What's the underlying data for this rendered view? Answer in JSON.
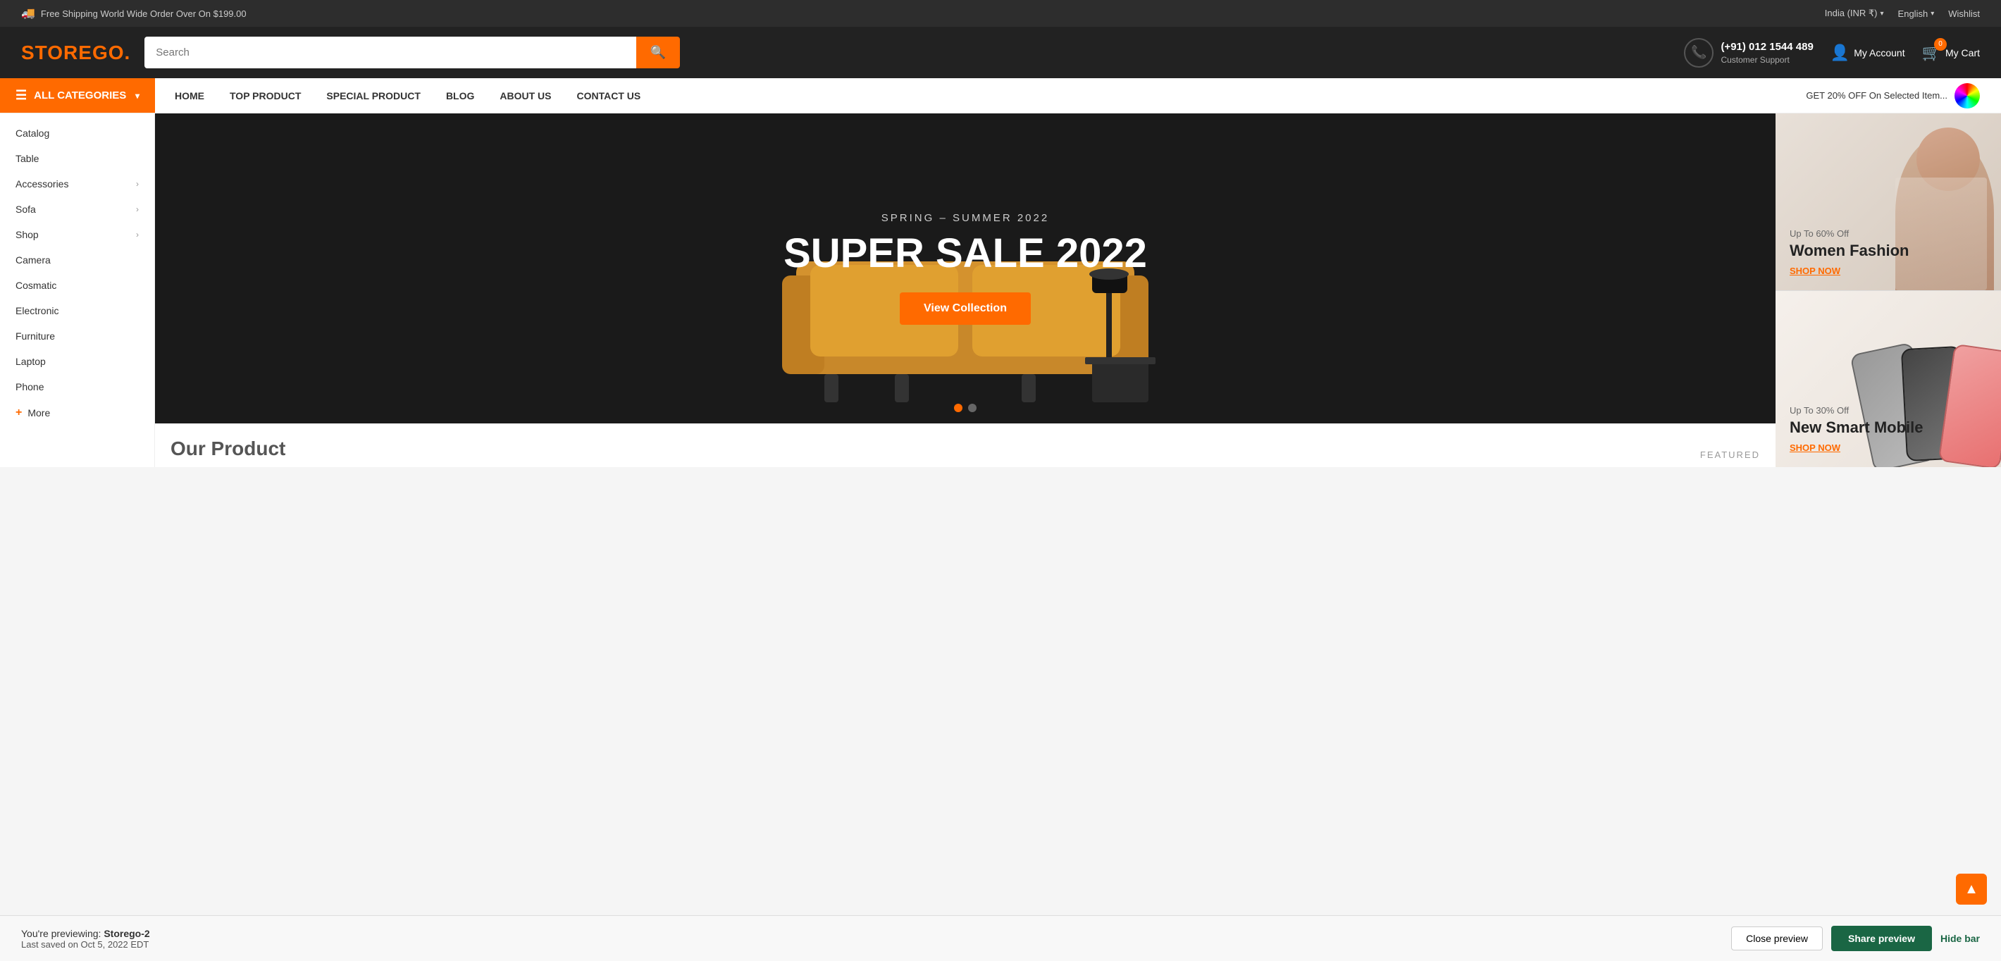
{
  "topbar": {
    "shipping_text": "Free Shipping World Wide Order Over On $199.00",
    "region": "India (INR ₹)",
    "language": "English",
    "wishlist": "Wishlist"
  },
  "header": {
    "logo_text": "STOREG",
    "logo_accent": "O.",
    "search_placeholder": "Search",
    "phone": "(+91) 012 1544 489",
    "support_label": "Customer Support",
    "my_account": "My Account",
    "my_cart": "My Cart",
    "cart_count": "0"
  },
  "navbar": {
    "all_categories": "ALL CATEGORIES",
    "links": [
      {
        "label": "HOME"
      },
      {
        "label": "TOP PRODUCT"
      },
      {
        "label": "SPECIAL PRODUCT"
      },
      {
        "label": "BLOG"
      },
      {
        "label": "ABOUT US"
      },
      {
        "label": "CONTACT US"
      }
    ],
    "promo": "GET 20% OFF On Selected Item..."
  },
  "sidebar": {
    "items": [
      {
        "label": "Catalog",
        "has_arrow": false
      },
      {
        "label": "Table",
        "has_arrow": false
      },
      {
        "label": "Accessories",
        "has_arrow": true
      },
      {
        "label": "Sofa",
        "has_arrow": true
      },
      {
        "label": "Shop",
        "has_arrow": true
      },
      {
        "label": "Camera",
        "has_arrow": false
      },
      {
        "label": "Cosmatic",
        "has_arrow": false
      },
      {
        "label": "Electronic",
        "has_arrow": false
      },
      {
        "label": "Furniture",
        "has_arrow": false
      },
      {
        "label": "Laptop",
        "has_arrow": false
      },
      {
        "label": "Phone",
        "has_arrow": false
      }
    ],
    "more_label": "More"
  },
  "hero": {
    "subtitle": "SPRING – SUMMER 2022",
    "title": "SUPER SALE 2022",
    "cta": "View Collection",
    "dots": [
      true,
      false
    ]
  },
  "banners": {
    "women": {
      "small": "Up To 60% Off",
      "large": "Women Fashion",
      "shop": "SHOP NOW"
    },
    "mobile": {
      "small": "Up To 30% Off",
      "large": "New Smart Mobile",
      "shop": "SHOP NOW"
    }
  },
  "product_section": {
    "title": "Our Product",
    "featured": "FEATURED"
  },
  "preview_bar": {
    "previewing_label": "You're previewing:",
    "store_name": "Storego-2",
    "saved_label": "Last saved on Oct 5, 2022 EDT",
    "close_btn": "Close preview",
    "share_btn": "Share preview",
    "hide_btn": "Hide bar"
  }
}
